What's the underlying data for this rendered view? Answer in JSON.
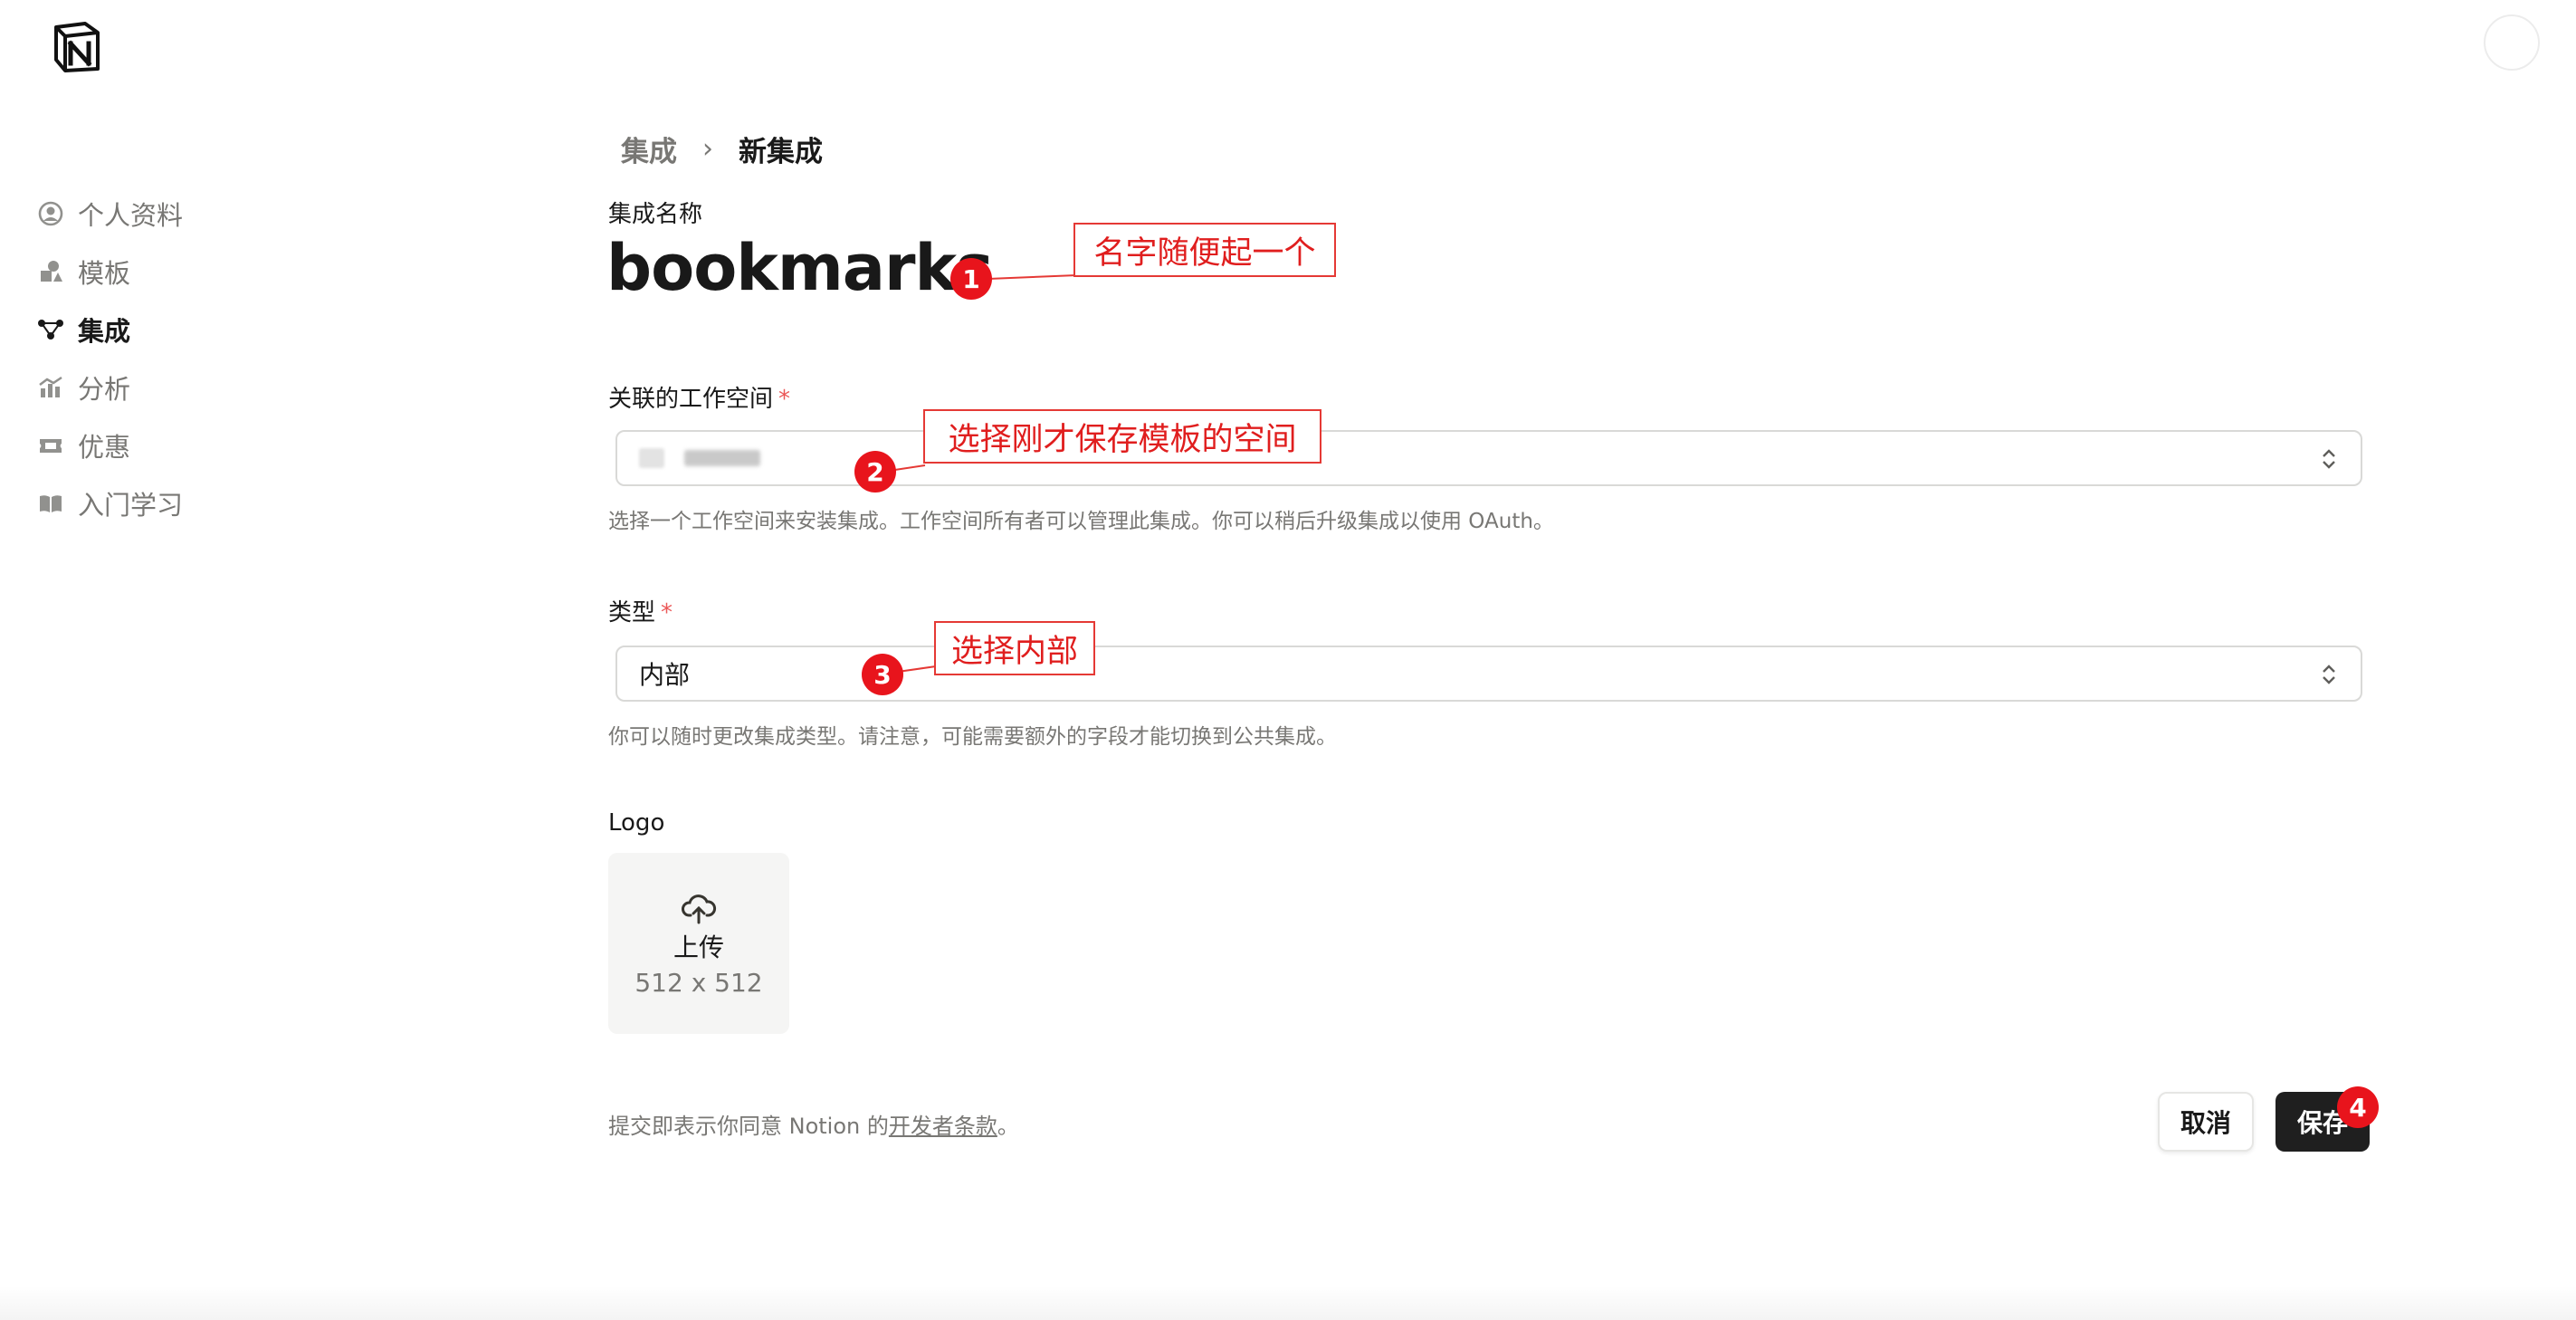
{
  "sidebar": {
    "items": [
      {
        "label": "个人资料",
        "icon": "person-circle-icon",
        "active": false
      },
      {
        "label": "模板",
        "icon": "shapes-icon",
        "active": false
      },
      {
        "label": "集成",
        "icon": "integration-nodes-icon",
        "active": true
      },
      {
        "label": "分析",
        "icon": "chart-icon",
        "active": false
      },
      {
        "label": "优惠",
        "icon": "ticket-icon",
        "active": false
      },
      {
        "label": "入门学习",
        "icon": "book-icon",
        "active": false
      }
    ]
  },
  "breadcrumb": {
    "parent": "集成",
    "separator": "›",
    "current": "新集成"
  },
  "form": {
    "name_label": "集成名称",
    "name_value": "bookmarks",
    "workspace_label": "关联的工作空间",
    "required_mark": "*",
    "workspace_help": "选择一个工作空间来安装集成。工作空间所有者可以管理此集成。你可以稍后升级集成以使用 OAuth。",
    "type_label": "类型",
    "type_value": "内部",
    "type_help": "你可以随时更改集成类型。请注意，可能需要额外的字段才能切换到公共集成。",
    "logo_label": "Logo",
    "upload_label": "上传",
    "upload_size": "512 x 512"
  },
  "footer": {
    "terms_prefix": "提交即表示你同意 Notion 的",
    "terms_link": "开发者条款",
    "terms_suffix": "。",
    "cancel_label": "取消",
    "save_label": "保存"
  },
  "annotations": [
    {
      "number": "1",
      "text": "名字随便起一个"
    },
    {
      "number": "2",
      "text": "选择刚才保存模板的空间"
    },
    {
      "number": "3",
      "text": "选择内部"
    },
    {
      "number": "4",
      "text": ""
    }
  ],
  "colors": {
    "accent_red": "#e8141c",
    "primary_button": "#1f1f1f",
    "required": "#eb5757"
  }
}
